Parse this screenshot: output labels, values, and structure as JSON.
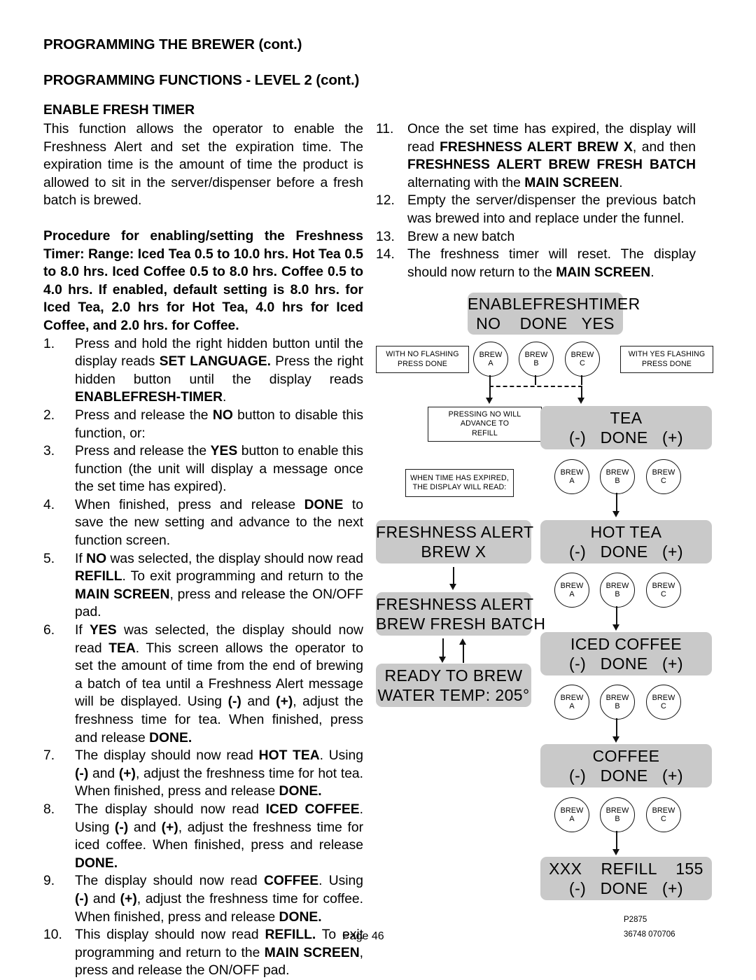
{
  "headers": {
    "brewer": "PROGRAMMING THE BREWER (cont.)",
    "level": "PROGRAMMING FUNCTIONS - LEVEL  2 (cont.)",
    "section": "ENABLE FRESH TIMER"
  },
  "intro": "This function allows the operator to enable the Freshness Alert and set the expiration time.  The expiration time is the amount of time the product is allowed to sit in the server/dispenser before a fresh batch is brewed.",
  "procedure": "Procedure for enabling/setting the Freshness Timer: Range:  Iced Tea 0.5 to 10.0 hrs.  Hot Tea 0.5 to 8.0 hrs.  Iced Coffee 0.5 to 8.0 hrs. Coffee 0.5 to 4.0 hrs. If enabled, default setting is 8.0 hrs. for Iced Tea, 2.0 hrs for Hot Tea, 4.0 hrs for Iced Coffee, and 2.0 hrs. for Coffee.",
  "steps_left": [
    {
      "num": "1.",
      "html": "Press and hold the right hidden button until the display reads <b>SET LANGUAGE.</b> Press the right hidden button until the display reads <b>ENABLEFRESH-TIMER</b>."
    },
    {
      "num": "2.",
      "html": "Press and release the <b>NO</b> button to disable this function, or:"
    },
    {
      "num": "3.",
      "html": "Press and release the <b>YES</b> button to enable this function (the unit will display a message once the set time has expired)."
    },
    {
      "num": "4.",
      "html": "When finished, press and release <b>DONE</b> to save the new setting and advance to the next function screen."
    },
    {
      "num": "5.",
      "html": "If <b>NO</b> was selected, the display should now read <b>REFILL</b>. To exit programming and return to the <b>MAIN SCREEN</b>, press and release the ON/OFF pad."
    },
    {
      "num": "6.",
      "html": "If <b>YES</b> was selected, the display should now read <b>TEA</b>.  This screen allows the operator to set the amount of time from the end of brewing a batch of tea until a Freshness Alert message will be displayed. Using <b>(-)</b> and <b>(+)</b>, adjust the freshness time for tea. When finished, press and release <b>DONE.</b>"
    },
    {
      "num": "7.",
      "html": "The display should now read <b>HOT TEA</b>. Using <b>(-)</b> and <b>(+)</b>, adjust the freshness time for hot tea. When finished, press and release <b>DONE.</b>"
    },
    {
      "num": "8.",
      "html": "The display should now read <b>ICED COFFEE</b>. Using <b>(-)</b> and <b>(+)</b>, adjust the freshness time for iced coffee. When finished, press and release <b>DONE.</b>"
    },
    {
      "num": "9.",
      "html": "The display should now read <b>COFFEE</b>. Using <b>(-)</b> and <b>(+)</b>, adjust the freshness time for coffee. When finished, press and release <b>DONE.</b>"
    },
    {
      "num": "10.",
      "html": "This display should now read <b>REFILL.</b> To exit programming and return to the <b>MAIN SCREEN</b>, press and release the ON/OFF pad."
    }
  ],
  "steps_right": [
    {
      "num": "11.",
      "html": "Once the set time has expired, the display will read <b>FRESHNESS ALERT BREW X</b>, and then <b>FRESHNESS ALERT BREW FRESH BATCH</b> alternating with the <b>MAIN SCREEN</b>."
    },
    {
      "num": "12.",
      "html": "Empty the server/dispenser the previous batch was brewed into and replace under the funnel."
    },
    {
      "num": "13.",
      "html": "Brew a new batch"
    },
    {
      "num": "14.",
      "html": "The freshness timer will reset.  The display should now return to the <b>MAIN SCREEN</b>."
    }
  ],
  "diagram": {
    "lcd_enable": {
      "line1": "ENABLEFRESHTIMER",
      "line2": "NO    DONE   YES"
    },
    "note_no_flash": {
      "line1": "WITH NO FLASHING",
      "line2": "PRESS DONE"
    },
    "note_yes_flash": {
      "line1": "WITH YES FLASHING",
      "line2": "PRESS DONE"
    },
    "note_pressing_no": {
      "line1": "PRESSING NO WILL",
      "line2": "ADVANCE TO",
      "line3": "REFILL"
    },
    "note_expired": {
      "line1": "WHEN TIME HAS EXPIRED,",
      "line2": "THE DISPLAY WILL READ:"
    },
    "lcd_alert_brewx": {
      "line1": "FRESHNESS ALERT",
      "line2": "BREW X"
    },
    "lcd_alert_fresh": {
      "line1": "FRESHNESS ALERT",
      "line2": "BREW FRESH BATCH"
    },
    "lcd_ready": {
      "line1": "READY TO BREW",
      "line2": "WATER TEMP: 205°"
    },
    "lcd_tea": {
      "line1": "TEA",
      "line2": "(-)   DONE   (+)"
    },
    "lcd_hot_tea": {
      "line1": "HOT TEA",
      "line2": "(-)   DONE   (+)"
    },
    "lcd_iced_coffee": {
      "line1": "ICED COFFEE",
      "line2": "(-)   DONE   (+)"
    },
    "lcd_coffee": {
      "line1": "COFFEE",
      "line2": "(-)   DONE   (+)"
    },
    "lcd_refill": {
      "line1": "XXX    REFILL    155",
      "line2": "(-)   DONE   (+)"
    },
    "brew_a": {
      "line1": "BREW",
      "line2": "A"
    },
    "brew_b": {
      "line1": "BREW",
      "line2": "B"
    },
    "brew_c": {
      "line1": "BREW",
      "line2": "C"
    }
  },
  "footer": {
    "page": "Page 46",
    "code1": "P2875",
    "code2": "36748 070706"
  }
}
